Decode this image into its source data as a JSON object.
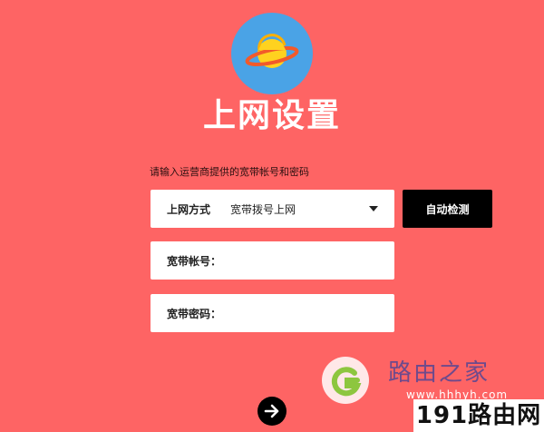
{
  "header": {
    "logo_icon": "planet-icon",
    "title": "上网设置"
  },
  "form": {
    "instruction": "请输入运营商提供的宽带帐号和密码",
    "connection_type": {
      "label": "上网方式",
      "selected": "宽带拨号上网"
    },
    "detect_button": "自动检测",
    "account": {
      "label": "宽带帐号：",
      "value": ""
    },
    "password": {
      "label": "宽带密码：",
      "value": ""
    },
    "next_icon": "arrow-right-icon"
  },
  "watermark": {
    "logo_icon": "leaf-logo-icon",
    "title": "路由之家",
    "url": "www.hhhyh.com",
    "badge": "191路由网"
  },
  "colors": {
    "background": "#fe6464",
    "button": "#000000",
    "field": "#ffffff",
    "logo_circle": "#4aa3e6"
  }
}
